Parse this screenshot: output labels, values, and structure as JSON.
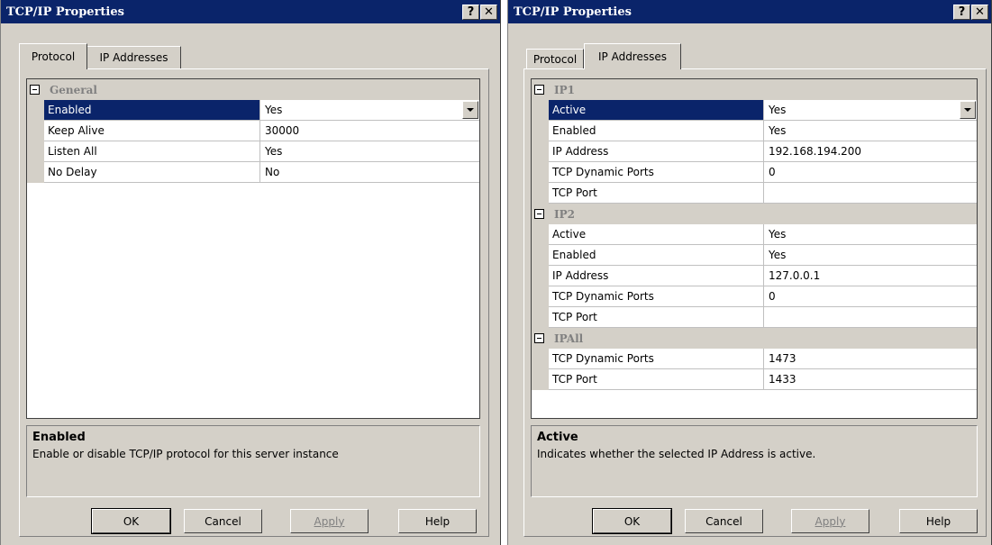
{
  "left_window": {
    "title": "TCP/IP Properties",
    "title_buttons": {
      "help": "?",
      "close": "✕"
    },
    "tabs": [
      {
        "label": "Protocol",
        "selected": true
      },
      {
        "label": "IP Addresses",
        "selected": false
      }
    ],
    "grid": {
      "categories": [
        {
          "label": "General",
          "properties": [
            {
              "name": "Enabled",
              "value": "Yes",
              "selected": true
            },
            {
              "name": "Keep Alive",
              "value": "30000"
            },
            {
              "name": "Listen All",
              "value": "Yes"
            },
            {
              "name": "No Delay",
              "value": "No"
            }
          ]
        }
      ]
    },
    "description": {
      "title": "Enabled",
      "text": "Enable or disable TCP/IP protocol for this server instance"
    },
    "buttons": {
      "ok": "OK",
      "cancel": "Cancel",
      "apply": "Apply",
      "help": "Help"
    }
  },
  "right_window": {
    "title": "TCP/IP Properties",
    "title_buttons": {
      "help": "?",
      "close": "✕"
    },
    "tabs": [
      {
        "label": "Protocol",
        "selected": false
      },
      {
        "label": "IP Addresses",
        "selected": true
      }
    ],
    "grid": {
      "categories": [
        {
          "label": "IP1",
          "properties": [
            {
              "name": "Active",
              "value": "Yes",
              "selected": true
            },
            {
              "name": "Enabled",
              "value": "Yes"
            },
            {
              "name": "IP Address",
              "value": "192.168.194.200"
            },
            {
              "name": "TCP Dynamic Ports",
              "value": "0"
            },
            {
              "name": "TCP Port",
              "value": ""
            }
          ]
        },
        {
          "label": "IP2",
          "properties": [
            {
              "name": "Active",
              "value": "Yes"
            },
            {
              "name": "Enabled",
              "value": "Yes"
            },
            {
              "name": "IP Address",
              "value": "127.0.0.1"
            },
            {
              "name": "TCP Dynamic Ports",
              "value": "0"
            },
            {
              "name": "TCP Port",
              "value": ""
            }
          ]
        },
        {
          "label": "IPAll",
          "properties": [
            {
              "name": "TCP Dynamic Ports",
              "value": "1473"
            },
            {
              "name": "TCP Port",
              "value": "1433"
            }
          ]
        }
      ]
    },
    "description": {
      "title": "Active",
      "text": "Indicates whether the selected IP Address is active."
    },
    "buttons": {
      "ok": "OK",
      "cancel": "Cancel",
      "apply": "Apply",
      "help": "Help"
    }
  }
}
